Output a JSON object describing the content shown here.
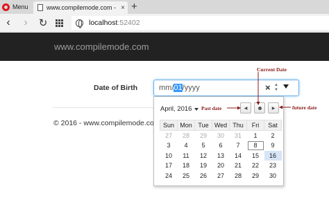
{
  "browser": {
    "menu_label": "Menu",
    "tab_title": "www.compilemode.com -",
    "tab_close": "×",
    "new_tab": "+",
    "url_host": "localhost",
    "url_port": ":52402",
    "back": "‹",
    "forward": "›",
    "reload": "↻"
  },
  "navbar": {
    "brand": "www.compilemode.com"
  },
  "form": {
    "label": "Date of Birth",
    "input_before": "mm/",
    "input_selected": "01",
    "input_after": "/yyyy",
    "clear": "×",
    "spin_up": "▲",
    "spin_down": "▼"
  },
  "footer": {
    "text": "© 2016 - www.compilemode.com"
  },
  "picker": {
    "month_label": "April, 2016",
    "prev": "◀",
    "next": "▶",
    "weekdays": [
      "Sun",
      "Mon",
      "Tue",
      "Wed",
      "Thu",
      "Fri",
      "Sat"
    ],
    "weeks": [
      [
        "27",
        "28",
        "29",
        "30",
        "31",
        "1",
        "2"
      ],
      [
        "3",
        "4",
        "5",
        "6",
        "7",
        "8",
        "9"
      ],
      [
        "10",
        "11",
        "12",
        "13",
        "14",
        "15",
        "16"
      ],
      [
        "17",
        "18",
        "19",
        "20",
        "21",
        "22",
        "23"
      ],
      [
        "24",
        "25",
        "26",
        "27",
        "28",
        "29",
        "30"
      ]
    ],
    "today": "8",
    "selected": "16"
  },
  "annotations": {
    "current": "Current Date",
    "past": "Past date",
    "future": "future date"
  },
  "colors": {
    "annotation": "#8b1a1a",
    "navbar": "#222222",
    "focus_border": "#66afe9",
    "opera_red": "#e0141e"
  }
}
